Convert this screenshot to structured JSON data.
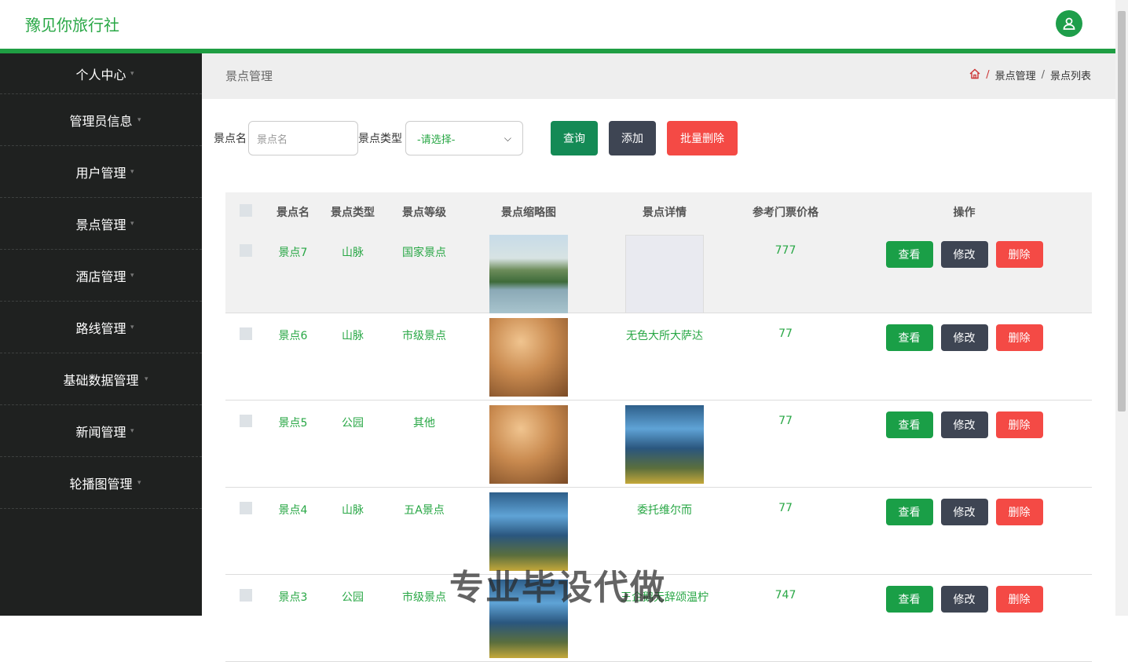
{
  "header": {
    "brand": "豫见你旅行社"
  },
  "sidebar": {
    "items": [
      {
        "label": "个人中心"
      },
      {
        "label": "管理员信息"
      },
      {
        "label": "用户管理"
      },
      {
        "label": "景点管理"
      },
      {
        "label": "酒店管理"
      },
      {
        "label": "路线管理"
      },
      {
        "label": "基础数据管理"
      },
      {
        "label": "新闻管理"
      },
      {
        "label": "轮播图管理"
      }
    ]
  },
  "page": {
    "title": "景点管理",
    "breadcrumb": [
      "景点管理",
      "景点列表"
    ]
  },
  "search": {
    "name_label": "景点名",
    "name_placeholder": "景点名",
    "type_label": "景点类型",
    "type_value": "-请选择-",
    "query_label": "查询",
    "add_label": "添加",
    "batch_delete_label": "批量删除"
  },
  "table": {
    "headers": [
      "景点名",
      "景点类型",
      "景点等级",
      "景点缩略图",
      "景点详情",
      "参考门票价格",
      "操作"
    ],
    "rows": [
      {
        "name": "景点7",
        "type": "山脉",
        "level": "国家景点",
        "thumb": "lake",
        "detail": "",
        "detail_img": "map",
        "price": "777"
      },
      {
        "name": "景点6",
        "type": "山脉",
        "level": "市级景点",
        "thumb": "hotel",
        "detail": "无色大所大萨达",
        "detail_img": "",
        "price": "77"
      },
      {
        "name": "景点5",
        "type": "公园",
        "level": "其他",
        "thumb": "hotel",
        "detail": "",
        "detail_img": "falls",
        "price": "77"
      },
      {
        "name": "景点4",
        "type": "山脉",
        "level": "五A景点",
        "thumb": "falls",
        "detail": "委托维尔而",
        "detail_img": "",
        "price": "77"
      },
      {
        "name": "景点3",
        "type": "公园",
        "level": "市级景点",
        "thumb": "falls",
        "detail": "王企鹅无辞颂温柠",
        "detail_img": "",
        "price": "747"
      }
    ],
    "ops": {
      "view": "查看",
      "edit": "修改",
      "delete": "删除"
    }
  },
  "watermark": "专业毕设代做",
  "colors": {
    "accent": "#28a745",
    "sidebar": "#1f2120",
    "danger": "#f44a45",
    "dark": "#3e4553"
  }
}
